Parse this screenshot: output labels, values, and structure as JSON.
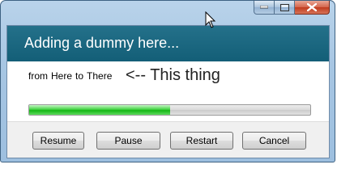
{
  "window": {
    "controls": [
      "minimize-icon",
      "maximize-icon",
      "close-icon"
    ]
  },
  "header": {
    "title": "Adding a dummy here..."
  },
  "content": {
    "from_label": "from",
    "from_value": "Here",
    "to_label": "to",
    "to_value": "There",
    "note": "<-- This thing"
  },
  "progress": {
    "percent": 50,
    "color": "#22c022"
  },
  "buttons": {
    "resume": "Resume",
    "pause": "Pause",
    "restart": "Restart",
    "cancel": "Cancel"
  },
  "colors": {
    "header_bg": "#1b6882",
    "window_frame": "#a7c6e3",
    "close_button": "#c9452b"
  }
}
